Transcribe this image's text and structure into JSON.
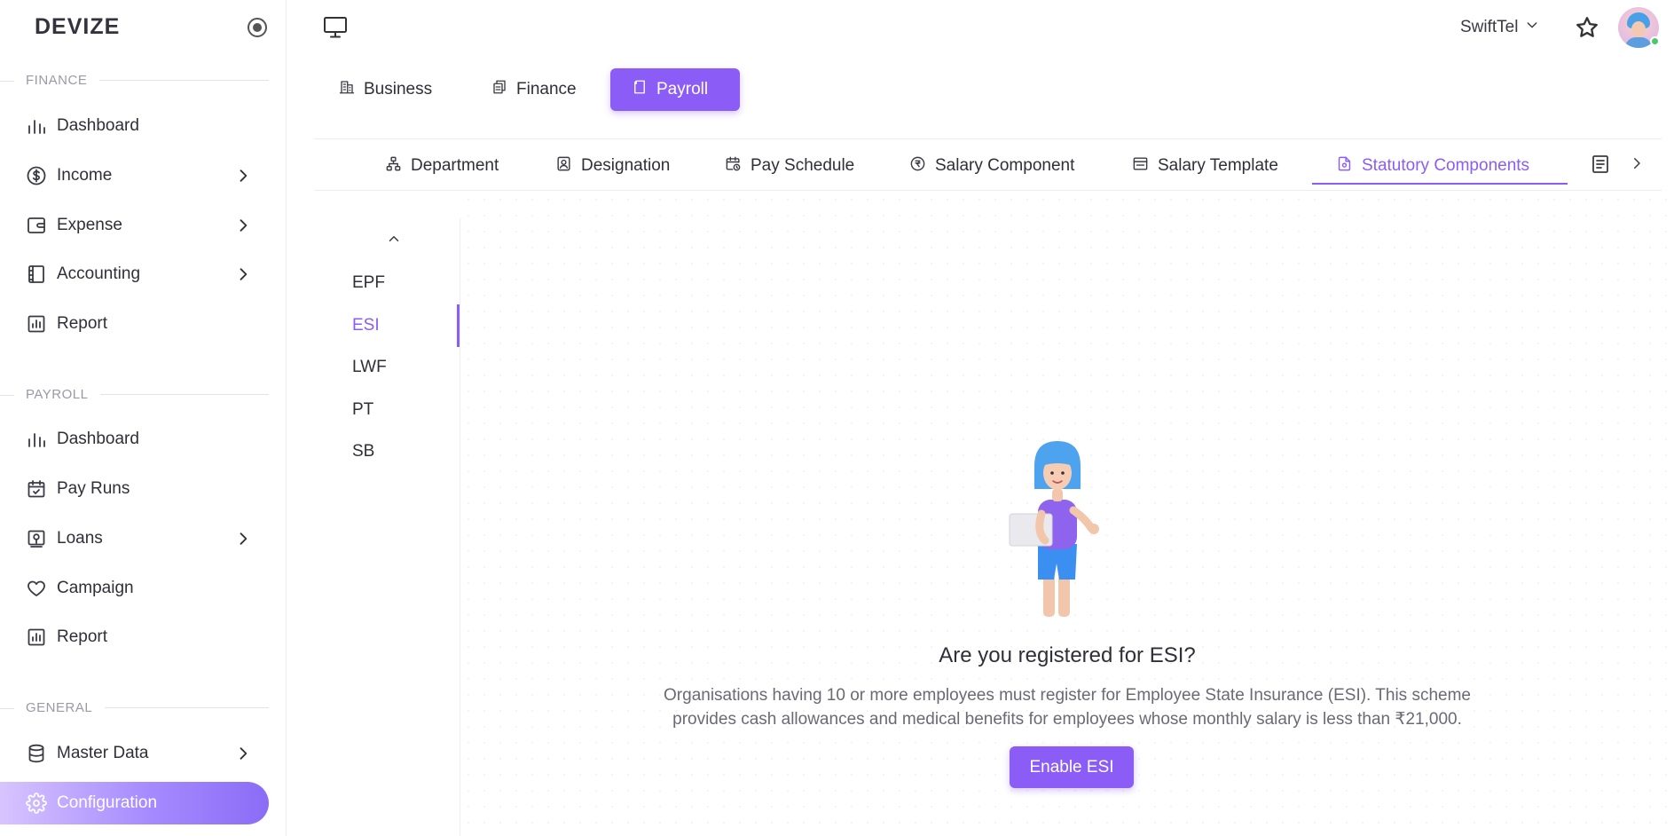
{
  "brand": "DEVIZE",
  "sidebar": {
    "sections": [
      {
        "label": "FINANCE",
        "items": [
          {
            "label": "Dashboard",
            "icon": "bar-chart-icon"
          },
          {
            "label": "Income",
            "icon": "dollar-circle-icon"
          },
          {
            "label": "Expense",
            "icon": "wallet-icon"
          },
          {
            "label": "Accounting",
            "icon": "ledger-icon"
          },
          {
            "label": "Report",
            "icon": "report-icon"
          }
        ]
      },
      {
        "label": "PAYROLL",
        "items": [
          {
            "label": "Dashboard",
            "icon": "bar-chart-icon"
          },
          {
            "label": "Pay Runs",
            "icon": "calendar-check-icon"
          },
          {
            "label": "Loans",
            "icon": "loan-icon"
          },
          {
            "label": "Campaign",
            "icon": "heart-icon"
          },
          {
            "label": "Report",
            "icon": "report-icon"
          }
        ]
      },
      {
        "label": "GENERAL",
        "items": [
          {
            "label": "Master Data",
            "icon": "database-icon"
          },
          {
            "label": "Configuration",
            "icon": "gear-icon"
          }
        ]
      }
    ]
  },
  "topbar": {
    "company": "SwiftTel"
  },
  "module_tabs": [
    {
      "label": "Business"
    },
    {
      "label": "Finance"
    },
    {
      "label": "Payroll"
    }
  ],
  "sub_tabs": [
    {
      "label": "Department"
    },
    {
      "label": "Designation"
    },
    {
      "label": "Pay Schedule"
    },
    {
      "label": "Salary Component"
    },
    {
      "label": "Salary Template"
    },
    {
      "label": "Statutory Components"
    }
  ],
  "statutory_list": [
    "EPF",
    "ESI",
    "LWF",
    "PT",
    "SB"
  ],
  "empty_state": {
    "title": "Are you registered for ESI?",
    "description": "Organisations having 10 or more employees must register for Employee State Insurance (ESI). This scheme provides cash allowances and medical benefits for employees whose monthly salary is less than ₹21,000.",
    "button": "Enable ESI"
  },
  "colors": {
    "accent": "#8b5cf6",
    "online": "#4cc76a"
  }
}
